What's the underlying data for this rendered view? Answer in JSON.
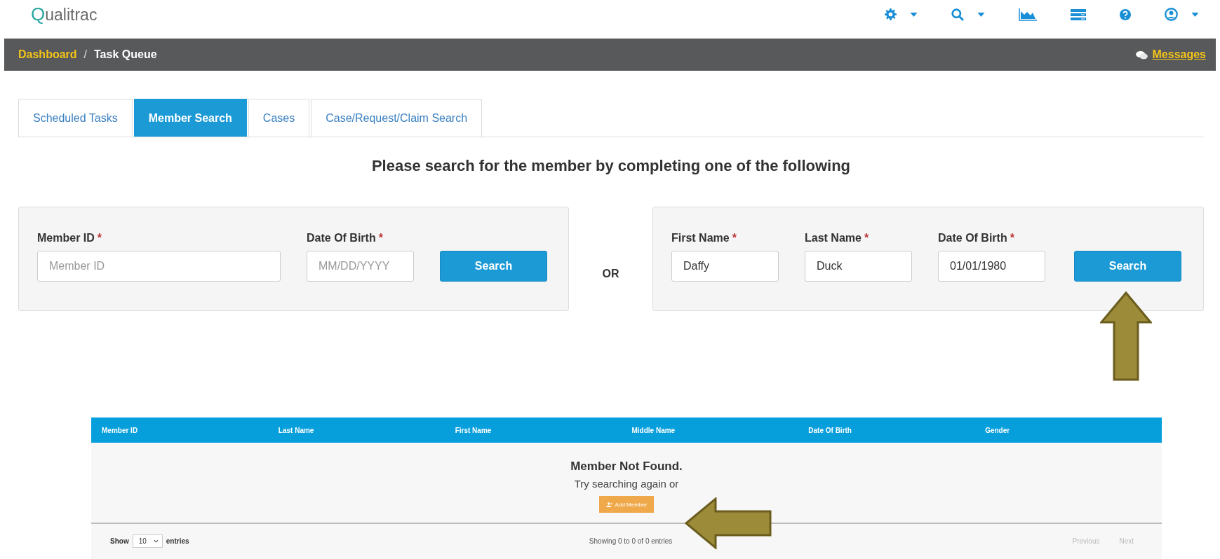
{
  "header": {
    "logo": "Qualitrac"
  },
  "breadcrumb": {
    "items": [
      {
        "label": "Dashboard",
        "link": true
      },
      {
        "label": "Task Queue",
        "link": false
      }
    ],
    "separator": "/",
    "messages": "Messages"
  },
  "tabs": [
    {
      "label": "Scheduled Tasks",
      "selected": false
    },
    {
      "label": "Member Search",
      "selected": true
    },
    {
      "label": "Cases",
      "selected": false
    },
    {
      "label": "Case/Request/Claim Search",
      "selected": false
    }
  ],
  "heading": "Please search for the member by completing one of the following",
  "panels": [
    {
      "fields": [
        {
          "label": "Member ID",
          "required_mark": "*",
          "placeholder": "Member ID"
        },
        {
          "label": "Date Of Birth",
          "required_mark": "*",
          "placeholder": "MM/DD/YYYY"
        }
      ],
      "button": "Search"
    },
    {
      "fields": [
        {
          "label": "First Name",
          "required_mark": "*",
          "value": "Daffy"
        },
        {
          "label": "Last Name",
          "required_mark": "*",
          "value": "Duck"
        },
        {
          "label": "Date Of Birth",
          "required_mark": "*",
          "value": "01/01/1980"
        }
      ],
      "button": "Search"
    }
  ],
  "or_label": "OR",
  "results": {
    "columns": [
      "Member ID",
      "Last Name",
      "First Name",
      "Middle Name",
      "Date Of Birth",
      "Gender"
    ],
    "message_title": "Member Not Found.",
    "message_text": "Try searching again or",
    "add_button": "Add Member",
    "show_label": "Show",
    "page_size": "10",
    "entries_label": "entries",
    "info": "Showing 0 to 0 of 0 entries",
    "pagination": [
      {
        "label": "Previous",
        "disabled": true
      },
      {
        "label": "Next",
        "disabled": true
      }
    ]
  }
}
